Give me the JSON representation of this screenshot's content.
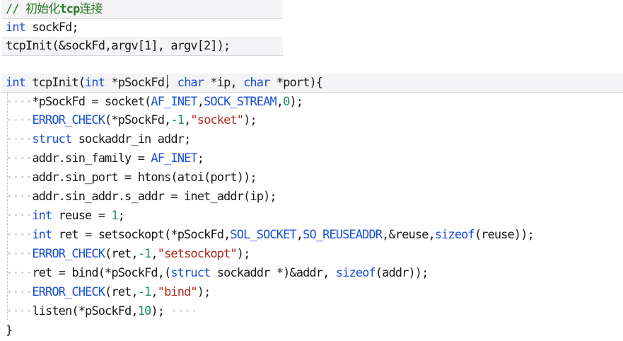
{
  "code": {
    "comment": {
      "slashes": "//",
      "text": "初始化",
      "bold_word": "tcp",
      "rest": "连接"
    },
    "decl_type": "int",
    "decl_rest": " sockFd;",
    "call": "tcpInit(&sockFd,argv[1], argv[2]);",
    "func": {
      "ret_type": "int",
      "name": " tcpInit(",
      "p1_type": "int",
      "p1_name": " *pSockFd, ",
      "p2_type": "char",
      "p2_name": " *ip, ",
      "p3_type": "char",
      "p3_name": " *port){"
    },
    "body": {
      "l1_a": "*pSockFd = socket(",
      "l1_c1": "AF_INET",
      "l1_comma": ",",
      "l1_c2": "SOCK_STREAM",
      "l1_comma2": ",",
      "l1_num": "0",
      "l1_end": ");",
      "l2_macro": "ERROR_CHECK",
      "l2_a": "(*pSockFd,",
      "l2_num": "-1",
      "l2_comma": ",",
      "l2_str": "\"socket\"",
      "l2_end": ");",
      "l3_kw": "struct",
      "l3_rest": " sockaddr_in addr;",
      "l4_a": "addr.sin_family = ",
      "l4_c": "AF_INET",
      "l4_end": ";",
      "l5": "addr.sin_port = htons(atoi(port));",
      "l6": "addr.sin_addr.s_addr = inet_addr(ip);",
      "l7_kw": "int",
      "l7_a": " reuse = ",
      "l7_num": "1",
      "l7_end": ";",
      "l8_kw": "int",
      "l8_a": " ret = setsockopt(*pSockFd,",
      "l8_c1": "SOL_SOCKET",
      "l8_comma": ",",
      "l8_c2": "SO_REUSEADDR",
      "l8_b": ",&reuse,",
      "l8_kw2": "sizeof",
      "l8_end": "(reuse));",
      "l9_macro": "ERROR_CHECK",
      "l9_a": "(ret,",
      "l9_num": "-1",
      "l9_comma": ",",
      "l9_str": "\"setsockopt\"",
      "l9_end": ");",
      "l10_a": "ret = bind(*pSockFd,(",
      "l10_kw": "struct",
      "l10_b": " sockaddr *)&addr, ",
      "l10_kw2": "sizeof",
      "l10_end": "(addr));",
      "l11_macro": "ERROR_CHECK",
      "l11_a": "(ret,",
      "l11_num": "-1",
      "l11_comma": ",",
      "l11_str": "\"bind\"",
      "l11_end": ");",
      "l12_a": "listen(*pSockFd,",
      "l12_num": "10",
      "l12_end": ");"
    },
    "close_brace": "}"
  },
  "whitespace": {
    "indent": "····",
    "trail": " ····"
  },
  "colors": {
    "keyword": "#1a4fd6",
    "string": "#b02a1d",
    "number": "#1f8a6a",
    "comment": "#2a7a2a",
    "whitespace_marker": "#c0c0c0"
  }
}
